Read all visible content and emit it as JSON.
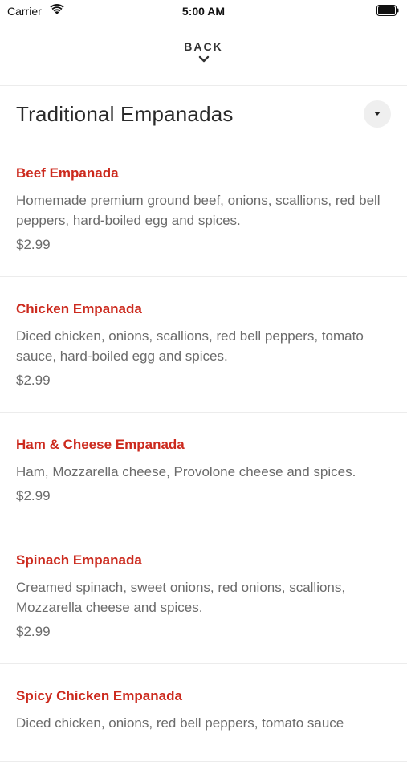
{
  "status_bar": {
    "carrier": "Carrier",
    "time": "5:00 AM"
  },
  "nav": {
    "back_label": "BACK"
  },
  "category": {
    "title": "Traditional Empanadas"
  },
  "colors": {
    "item_name": "#cc2a1e",
    "text_secondary": "#6b6b6b"
  },
  "menu_items": [
    {
      "name": "Beef Empanada",
      "description": "Homemade premium ground beef, onions, scallions, red bell peppers, hard-boiled egg and spices.",
      "price": "$2.99"
    },
    {
      "name": "Chicken Empanada",
      "description": "Diced chicken, onions, scallions, red bell peppers, tomato sauce, hard-boiled egg and spices.",
      "price": "$2.99"
    },
    {
      "name": "Ham & Cheese Empanada",
      "description": "Ham, Mozzarella cheese, Provolone cheese and spices.",
      "price": "$2.99"
    },
    {
      "name": "Spinach Empanada",
      "description": "Creamed spinach, sweet onions, red onions, scallions, Mozzarella cheese and spices.",
      "price": "$2.99"
    },
    {
      "name": "Spicy Chicken Empanada",
      "description": "Diced chicken, onions, red bell peppers, tomato sauce",
      "price": ""
    }
  ]
}
